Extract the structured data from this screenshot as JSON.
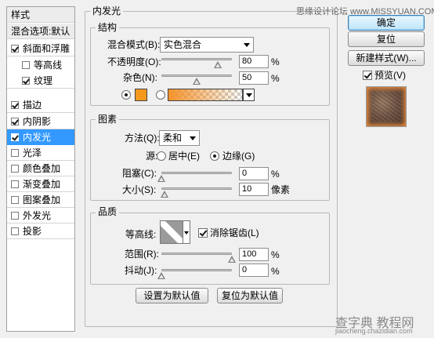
{
  "style_list": {
    "header": "样式",
    "blend_default": "混合选项:默认",
    "items": [
      {
        "label": "斜面和浮雕",
        "checked": true
      },
      {
        "label": "等高线",
        "checked": false
      },
      {
        "label": "纹理",
        "checked": true
      },
      {
        "label": "描边",
        "checked": true
      },
      {
        "label": "内阴影",
        "checked": true
      },
      {
        "label": "内发光",
        "checked": true
      },
      {
        "label": "光泽",
        "checked": false
      },
      {
        "label": "颜色叠加",
        "checked": false
      },
      {
        "label": "渐变叠加",
        "checked": false
      },
      {
        "label": "图案叠加",
        "checked": false
      },
      {
        "label": "外发光",
        "checked": false
      },
      {
        "label": "投影",
        "checked": false
      }
    ],
    "selected": "内发光"
  },
  "panel": {
    "title": "内发光",
    "structure": {
      "legend": "结构",
      "blend_mode_label": "混合模式(B):",
      "blend_mode_value": "实色混合",
      "opacity_label": "不透明度(O):",
      "opacity_value": "80",
      "opacity_percent": 80,
      "noise_label": "杂色(N):",
      "noise_value": "50",
      "noise_percent": 50,
      "percent_sign": "%",
      "glow_color": "#f39a1e"
    },
    "elements": {
      "legend": "图素",
      "method_label": "方法(Q):",
      "method_value": "柔和",
      "source_label": "源:",
      "source_center": "居中(E)",
      "source_edge": "边缘(G)",
      "choke_label": "阻塞(C):",
      "choke_value": "0",
      "choke_percent": 0,
      "size_label": "大小(S):",
      "size_value": "10",
      "size_unit": "像素",
      "size_fraction": 0.04,
      "percent_sign": "%"
    },
    "quality": {
      "legend": "品质",
      "contour_label": "等高线:",
      "antialias_label": "消除锯齿(L)",
      "range_label": "范围(R):",
      "range_value": "100",
      "range_percent": 100,
      "jitter_label": "抖动(J):",
      "jitter_value": "0",
      "jitter_percent": 0,
      "percent_sign": "%"
    },
    "make_default": "设置为默认值",
    "reset_default": "复位为默认值"
  },
  "buttons": {
    "ok": "确定",
    "reset": "复位",
    "new_style": "新建样式(W)...",
    "preview_label": "预览(V)"
  },
  "watermarks": {
    "top": "思缘设计论坛 www.MISSYUAN.COM",
    "bottom": "查字典 教程网",
    "bottom_url": "jiaocheng.chazidian.com"
  }
}
